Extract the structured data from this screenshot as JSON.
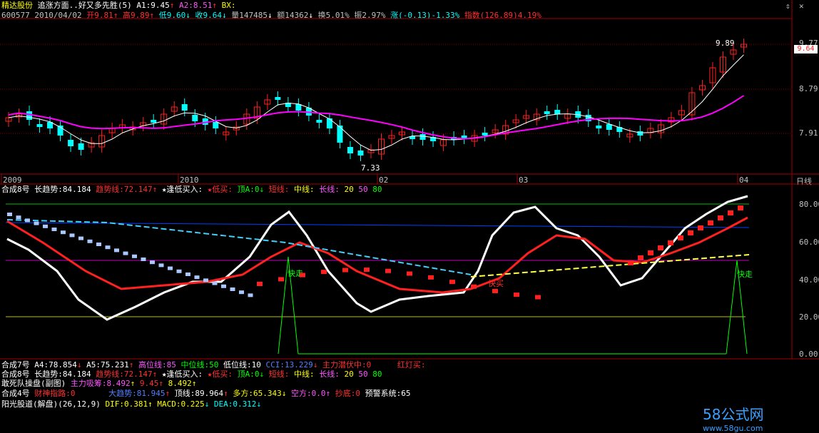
{
  "header": {
    "app_name": "精达股份",
    "formula_title": "追涨方面..好又多先胜(5)",
    "a1": "A1:9.45",
    "a2": "A2:8.51",
    "bx": "BX:"
  },
  "quote": {
    "code_date": "600577 2010/04/02",
    "open": "开9.81",
    "high": "高9.89",
    "low": "低9.60",
    "close": "收9.64",
    "volume": "量147485",
    "amount": "额14362",
    "turnover": "换5.01%",
    "amplitude": "振2.97%",
    "change": "涨(-0.13)-1.33%",
    "index": "指数(126.89)4.19%"
  },
  "price_axis": {
    "labels": [
      "9.77",
      "8.79",
      "7.91"
    ],
    "current_tag": "9.64"
  },
  "price_annotations": {
    "high_label": "9.89",
    "low_label": "7.33"
  },
  "time_axis": {
    "labels": [
      {
        "text": "2009"
      },
      {
        "text": "2010"
      },
      {
        "text": "02"
      },
      {
        "text": "03"
      },
      {
        "text": "04"
      }
    ],
    "period": "日线"
  },
  "sub_panel": {
    "title": "合成8号",
    "long_trend": "长趋势:84.184",
    "trend_line": "趋势线:72.147",
    "buy_signal": "★逢低买入:",
    "low_buy": "★低买:",
    "top_a": "顶A:0",
    "short_line": "短线:",
    "mid_line": "中线:",
    "long_line": "长线:",
    "p20": "20",
    "p50": "50",
    "p80": "80",
    "axis_labels": [
      "80.00",
      "60.00",
      "40.00",
      "20.00",
      "0.00"
    ],
    "annotations": [
      "快走",
      "快走",
      "快买"
    ]
  },
  "bottom_lines": {
    "l1": {
      "title": "合成7号",
      "a4": "A4:78.854",
      "a5": "A5:75.231",
      "high_line": "高位线:85",
      "mid_line": "中位线:50",
      "low_line": "低位线:10",
      "cci": "CCI:13.229",
      "main_lurk": "主力潜伏中:0",
      "red_light": "红灯买:"
    },
    "l2": {
      "title": "合成8号",
      "long_trend": "长趋势:84.184",
      "trend_line": "趋势线:72.147",
      "buy_signal": "★逢低买入:",
      "low_buy": "★低买:",
      "top_a": "顶A:0",
      "short_line": "短线:",
      "mid_line": "中线:",
      "long_line": "长线:",
      "p20": "20",
      "p50": "50",
      "p80": "80"
    },
    "l3": {
      "title": "敢死队操盘(副图)",
      "main_absorb": "主力吸筹:8.492",
      "v2": "9.45",
      "v3": "8.492"
    },
    "l4": {
      "title": "合成4号",
      "wealth_road": "财神指路:0",
      "big_trend": "大趋势:81.945",
      "top_line": "顶线:89.964",
      "bull": "多方:65.343",
      "bear": "空方:0.0",
      "bottom_pick": "抄底:0",
      "alert_system": "预警系统:65"
    },
    "l5": {
      "title": "阳光股道(解盘)(26,12,9)",
      "dif": "DIF:0.381",
      "macd": "MACD:0.225",
      "dea": "DEA:0.312"
    }
  },
  "watermark": {
    "brand": "58公式网",
    "url": "www.58gu.com"
  },
  "colors": {
    "up_candle": "#ff2020",
    "down_candle": "#00ffff",
    "ma_short": "#ffffff",
    "ma_long": "#ff00ff",
    "trend_red": "#ff2020",
    "signal_green": "#00ff00"
  }
}
